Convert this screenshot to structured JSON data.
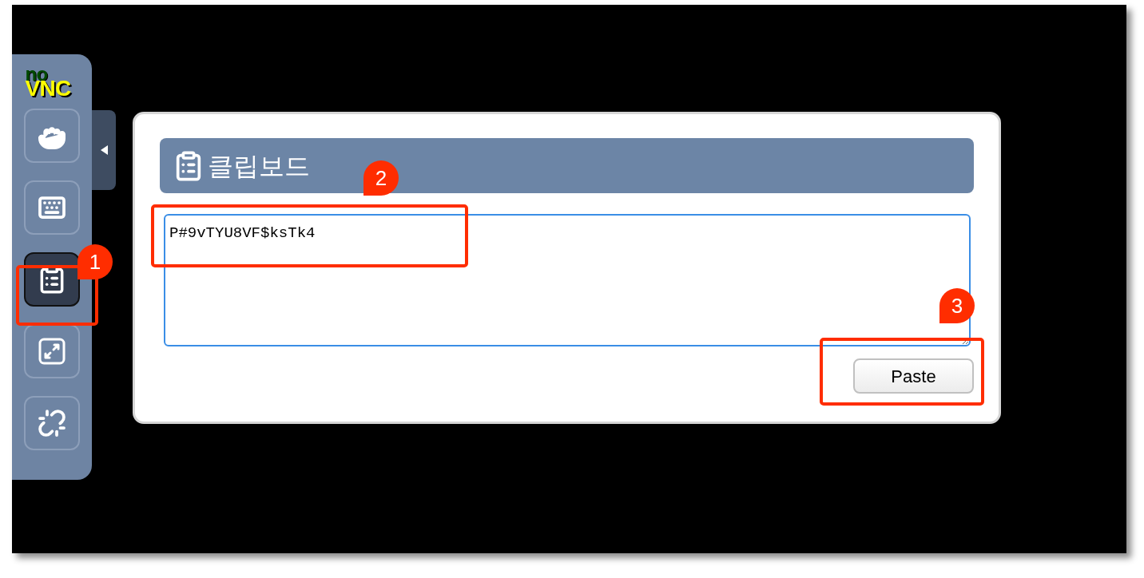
{
  "sidebar": {
    "logo": {
      "top": "no",
      "bottom": "VNC"
    },
    "buttons": [
      {
        "kind": "drag",
        "selected": false
      },
      {
        "kind": "keyboard",
        "selected": false
      },
      {
        "kind": "clipboard",
        "selected": true
      },
      {
        "kind": "fullscreen",
        "selected": false
      },
      {
        "kind": "disconnect",
        "selected": false
      }
    ]
  },
  "clipboard": {
    "title": "클립보드",
    "text": "P#9vTYU8VF$ksTk4",
    "button": "Paste"
  },
  "annotations": [
    {
      "number": "1"
    },
    {
      "number": "2"
    },
    {
      "number": "3"
    }
  ]
}
